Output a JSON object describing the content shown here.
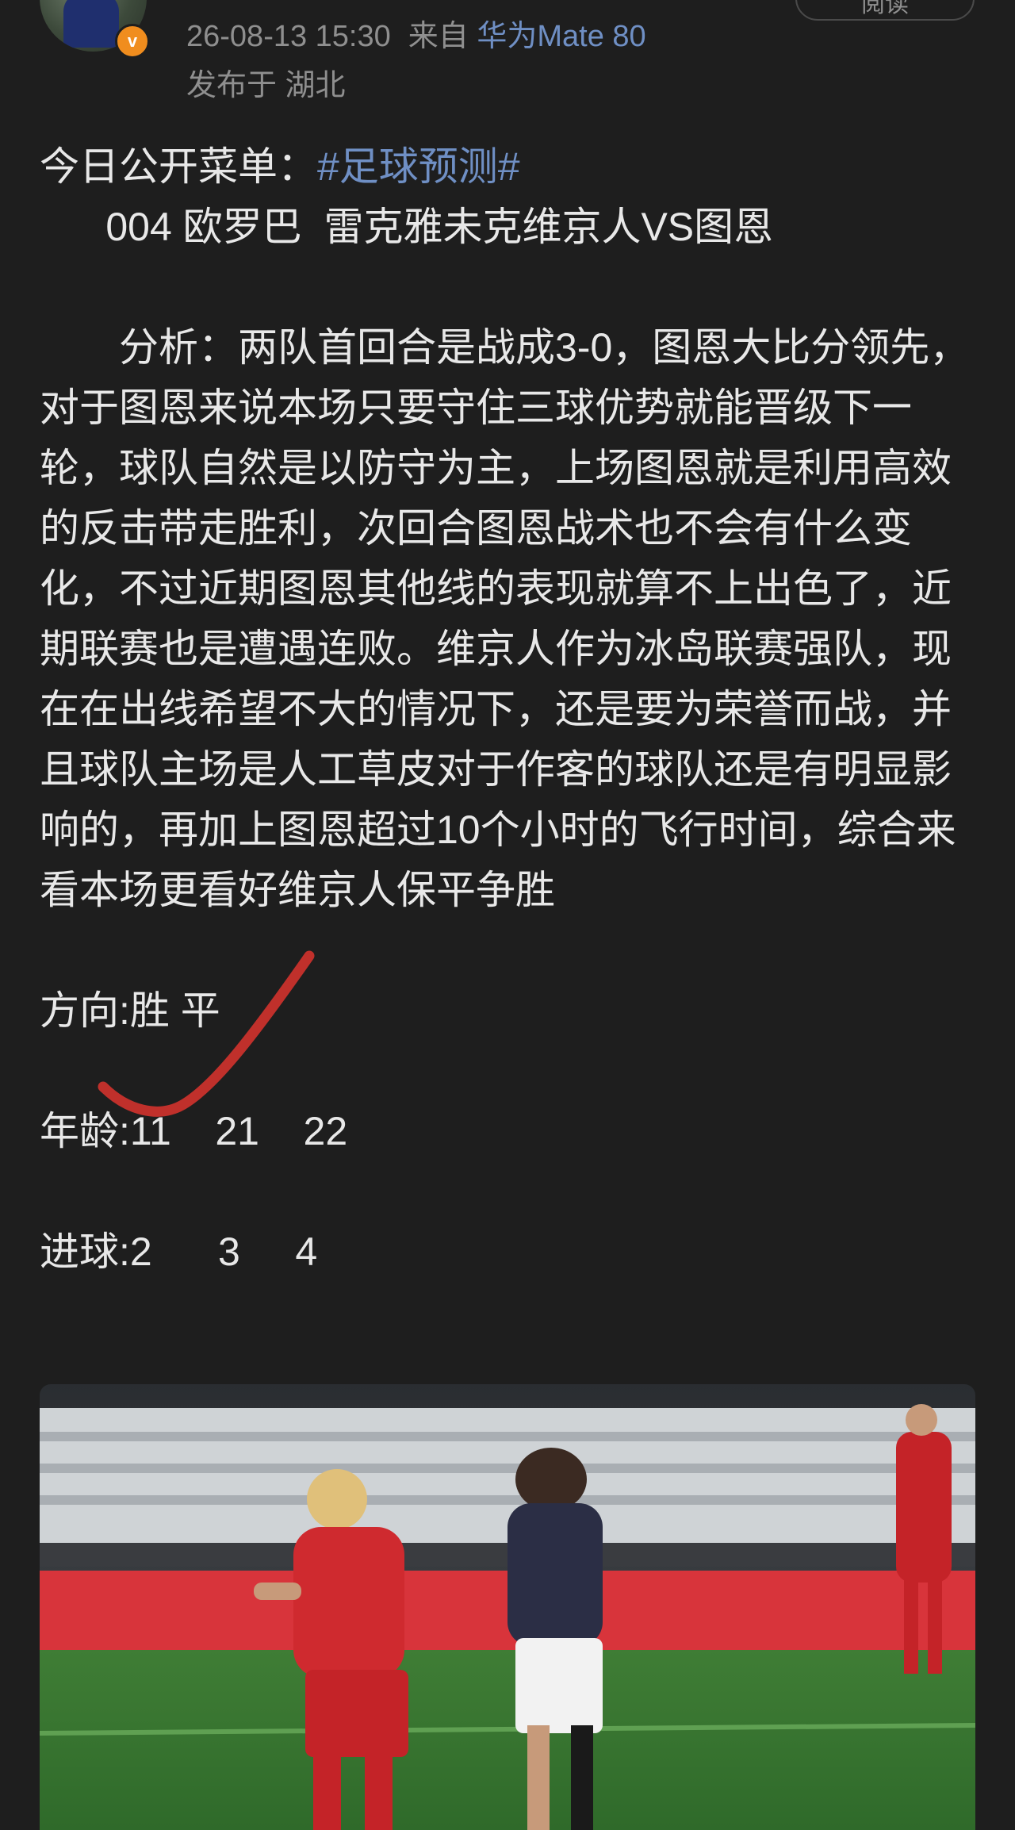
{
  "post": {
    "avatar_badge": "v",
    "timestamp": "26-08-13 15:30",
    "from_label": "来自",
    "device": "华为Mate 80",
    "location": "发布于 湖北",
    "read_button": "阅读"
  },
  "content": {
    "intro_prefix": "今日公开菜单：",
    "hashtag": "#足球预测#",
    "match": "      004 欧罗巴  雷克雅未克维京人VS图恩",
    "analysis": "分析：两队首回合是战成3-0，图恩大比分领先，对于图恩来说本场只要守住三球优势就能晋级下一轮，球队自然是以防守为主，上场图恩就是利用高效的反击带走胜利，次回合图恩战术也不会有什么变化，不过近期图恩其他线的表现就算不上出色了，近期联赛也是遭遇连败。维京人作为冰岛联赛强队，现在在出线希望不大的情况下，还是要为荣誉而战，并且球队主场是人工草皮对于作客的球队还是有明显影响的，再加上图恩超过10个小时的飞行时间，综合来看本场更看好维京人保平争胜",
    "direction": "方向:胜 平",
    "age": "年龄:11    21    22",
    "goals": "进球:2      3     4"
  },
  "colors": {
    "background": "#1e1e1e",
    "text": "#e8e8e8",
    "muted": "#8f8f8f",
    "link": "#6f8fc4",
    "badge": "#f08d1e",
    "checkmark": "#c0302b"
  }
}
